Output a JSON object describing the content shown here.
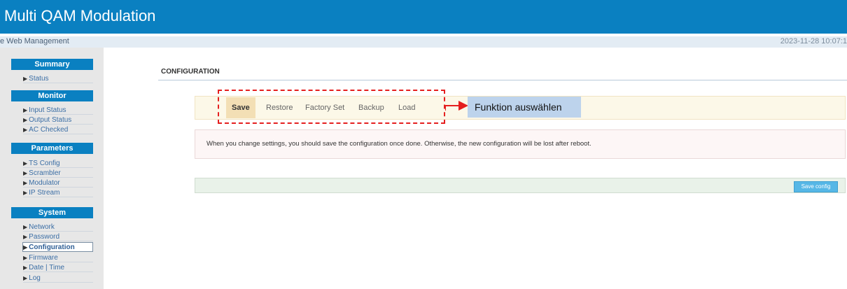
{
  "header": {
    "title": "Multi QAM Modulation"
  },
  "subbar": {
    "subtitle": "e Web Management",
    "datetime": "2023-11-28 10:07:1"
  },
  "sidebar": {
    "summary": {
      "title": "Summary",
      "items": [
        "Status"
      ]
    },
    "monitor": {
      "title": "Monitor",
      "items": [
        "Input Status",
        "Output Status",
        "AC Checked"
      ]
    },
    "parameters": {
      "title": "Parameters",
      "items": [
        "TS Config",
        "Scrambler",
        "Modulator",
        "IP Stream"
      ]
    },
    "system": {
      "title": "System",
      "items": [
        "Network",
        "Password",
        "Configuration",
        "Firmware",
        "Date | Time",
        "Log"
      ],
      "active": "Configuration"
    },
    "arrow_glyph": "▶"
  },
  "main": {
    "section_title": "CONFIGURATION",
    "toolbar": {
      "buttons": [
        "Save",
        "Restore",
        "Factory Set",
        "Backup",
        "Load"
      ],
      "active": "Save"
    },
    "callout": "Funktion auswählen",
    "alert": "When you change settings, you should save the configuration once done. Otherwise, the new configuration will be lost after reboot.",
    "save_config_label": "Save config"
  },
  "colors": {
    "header_blue": "#0a80c1",
    "annotation_red": "#e51f1f",
    "callout_blue": "#bdd3ec",
    "save_button_blue": "#56b7e6"
  }
}
